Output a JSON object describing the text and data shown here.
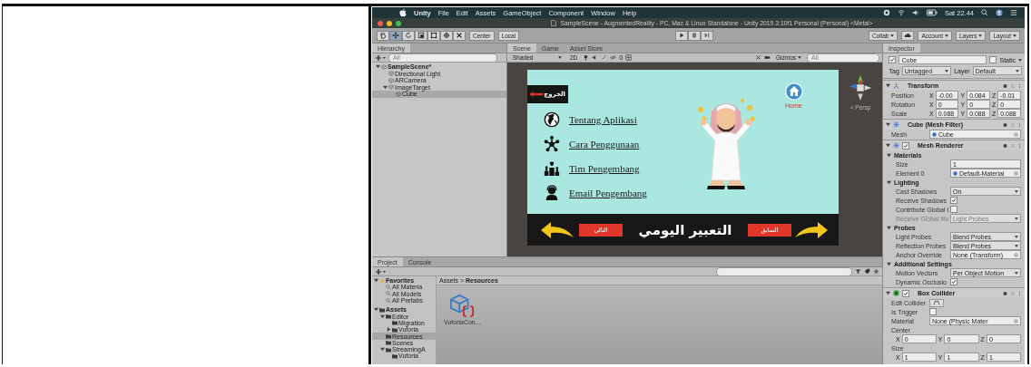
{
  "menu_bar": {
    "items": [
      {
        "label": "Unity",
        "kind": "app"
      },
      {
        "label": "File",
        "kind": "menu"
      },
      {
        "label": "Edit",
        "kind": "menu"
      },
      {
        "label": "Assets",
        "kind": "menu"
      },
      {
        "label": "GameObject",
        "kind": "menu"
      },
      {
        "label": "Component",
        "kind": "menu"
      },
      {
        "label": "Window",
        "kind": "menu"
      },
      {
        "label": "Help",
        "kind": "menu"
      }
    ],
    "clock": "Sat 22.44"
  },
  "window": {
    "title": "SampleScene - AugmentedReality - PC, Mac & Linux Standalone - Unity 2019.3.10f1 Personal (Personal) <Metal>"
  },
  "toolbar": {
    "tools": [
      {
        "selected": false
      },
      {
        "selected": true
      },
      {
        "selected": false
      },
      {
        "selected": false
      },
      {
        "selected": false
      },
      {
        "selected": false
      },
      {
        "selected": false
      }
    ],
    "pivot_buttons": [
      "Center",
      "Local"
    ],
    "right_dropdowns": [
      "Collab",
      "Account",
      "Layers",
      "Layout"
    ]
  },
  "hierarchy": {
    "tab": "Hierarchy",
    "search": {
      "placeholder": "All"
    },
    "tree": [
      {
        "label": "SampleScene*",
        "selected": false,
        "children": [
          {
            "label": "Directional Light",
            "selected": false
          },
          {
            "label": "ARCamera",
            "selected": false
          },
          {
            "label": "ImageTarget",
            "selected": false,
            "children": [
              {
                "label": "Cube",
                "selected": true
              }
            ]
          }
        ]
      }
    ]
  },
  "scene": {
    "tabs": [
      {
        "label": "Scene",
        "selected": true
      },
      {
        "label": "Game",
        "selected": false
      },
      {
        "label": "Asset Store",
        "selected": false
      }
    ],
    "shading": "Shaded",
    "mode_2d": "2D",
    "hidden_count": "0",
    "gizmos": "Gizmos",
    "search": {
      "placeholder": "All"
    },
    "camera_label": "< Persp",
    "game": {
      "exit_label": "الخروج",
      "home_label": "Home",
      "menu": [
        "Tentang Aplikasi",
        "Cara Penggunaan",
        "Tim Pengembang",
        "Email Pengembang"
      ],
      "next_label": "التالي",
      "title": "التعبير اليومي",
      "prev_label": "السابق"
    }
  },
  "inspector": {
    "tab": "Inspector",
    "object": {
      "checked": true,
      "name": "Cube",
      "static_checked": false,
      "static_label": "Static",
      "tag_label": "Tag",
      "tag": "Untagged",
      "layer_label": "Layer",
      "layer": "Default"
    },
    "components": [
      {
        "title": "Transform",
        "kind": "transform",
        "rows": [
          {
            "kind": "vector",
            "label": "Position",
            "values": [
              {
                "axis": "X",
                "value": "-0.00"
              },
              {
                "axis": "Y",
                "value": "0.084"
              },
              {
                "axis": "Z",
                "value": "-0.01"
              }
            ]
          },
          {
            "kind": "vector",
            "label": "Rotation",
            "values": [
              {
                "axis": "X",
                "value": "0"
              },
              {
                "axis": "Y",
                "value": "0"
              },
              {
                "axis": "Z",
                "value": "0"
              }
            ]
          },
          {
            "kind": "vector",
            "label": "Scale",
            "values": [
              {
                "axis": "X",
                "value": "0.088"
              },
              {
                "axis": "Y",
                "value": "0.088"
              },
              {
                "axis": "Z",
                "value": "0.088"
              }
            ]
          }
        ]
      },
      {
        "title": "Cube (Mesh Filter)",
        "kind": "mesh-filter",
        "rows": [
          {
            "kind": "asset",
            "label": "Mesh",
            "value": "Cube"
          }
        ]
      },
      {
        "title": "Mesh Renderer",
        "kind": "mesh-renderer",
        "toggle": {
          "checked": true
        },
        "rows": [
          {
            "kind": "group",
            "label": "Materials",
            "disabled": false
          },
          {
            "kind": "field",
            "label": "Size",
            "value": "1",
            "disabled": false
          },
          {
            "kind": "asset",
            "label": "Element 0",
            "value": "Default-Material",
            "disabled": false
          },
          {
            "kind": "group",
            "label": "Lighting",
            "disabled": false
          },
          {
            "kind": "dropdown",
            "label": "Cast Shadows",
            "value": "On",
            "disabled": false
          },
          {
            "kind": "checkbox",
            "label": "Receive Shadows",
            "checked": true,
            "disabled": false
          },
          {
            "kind": "checkbox",
            "label": "Contribute Global I",
            "checked": false,
            "disabled": false
          },
          {
            "kind": "dropdown",
            "label": "Receive Global Illu",
            "value": "Light Probes",
            "disabled": true
          },
          {
            "kind": "group",
            "label": "Probes",
            "disabled": false
          },
          {
            "kind": "dropdown",
            "label": "Light Probes",
            "value": "Blend Probes",
            "disabled": false
          },
          {
            "kind": "dropdown",
            "label": "Reflection Probes",
            "value": "Blend Probes",
            "disabled": false
          },
          {
            "kind": "object",
            "label": "Anchor Override",
            "value": "None (Transform)",
            "disabled": false
          },
          {
            "kind": "group",
            "label": "Additional Settings",
            "disabled": false
          },
          {
            "kind": "dropdown",
            "label": "Motion Vectors",
            "value": "Per Object Motion",
            "disabled": false
          },
          {
            "kind": "checkbox",
            "label": "Dynamic Occlusio",
            "checked": true,
            "disabled": false
          }
        ]
      },
      {
        "title": "Box Collider",
        "kind": "box-collider",
        "toggle": {
          "checked": true
        },
        "rows": [
          {
            "kind": "icon-button",
            "label": "Edit Collider"
          },
          {
            "kind": "checkbox",
            "label": "Is Trigger",
            "checked": false
          },
          {
            "kind": "object",
            "label": "Material",
            "value": "None (Physic Mater"
          },
          {
            "kind": "label",
            "label": "Center"
          },
          {
            "kind": "vector",
            "values": [
              {
                "axis": "X",
                "value": "0"
              },
              {
                "axis": "Y",
                "value": "0"
              },
              {
                "axis": "Z",
                "value": "0"
              }
            ]
          },
          {
            "kind": "label",
            "label": "Size"
          },
          {
            "kind": "vector",
            "values": [
              {
                "axis": "X",
                "value": "1"
              },
              {
                "axis": "Y",
                "value": "1"
              },
              {
                "axis": "Z",
                "value": "1"
              }
            ]
          }
        ]
      }
    ]
  },
  "project": {
    "tabs": [
      {
        "label": "Project",
        "selected": true
      },
      {
        "label": "Console",
        "selected": false
      }
    ],
    "sidebar": [
      {
        "label": "Favorites",
        "kind": "favorites",
        "selected": false,
        "children": [
          {
            "label": "All Materia",
            "kind": "search",
            "selected": false
          },
          {
            "label": "All Models",
            "kind": "search",
            "selected": false
          },
          {
            "label": "All Prefabs",
            "kind": "search",
            "selected": false
          }
        ]
      },
      {
        "label": "Assets",
        "kind": "folder",
        "selected": false,
        "children": [
          {
            "label": "Editor",
            "kind": "folder",
            "selected": false,
            "children": [
              {
                "label": "Migration",
                "kind": "folder",
                "selected": false
              },
              {
                "label": "Vuforia",
                "kind": "collapsed",
                "selected": false
              }
            ]
          },
          {
            "label": "Resources",
            "kind": "folder",
            "selected": true
          },
          {
            "label": "Scenes",
            "kind": "folder",
            "selected": false
          },
          {
            "label": "StreamingA",
            "kind": "folder",
            "selected": false,
            "children": [
              {
                "label": "Vuforia",
                "kind": "folder",
                "selected": false
              }
            ]
          }
        ]
      }
    ],
    "breadcrumb": "Assets > **Resources**",
    "assets": [
      {
        "label": "VuforiaCon..."
      }
    ]
  }
}
